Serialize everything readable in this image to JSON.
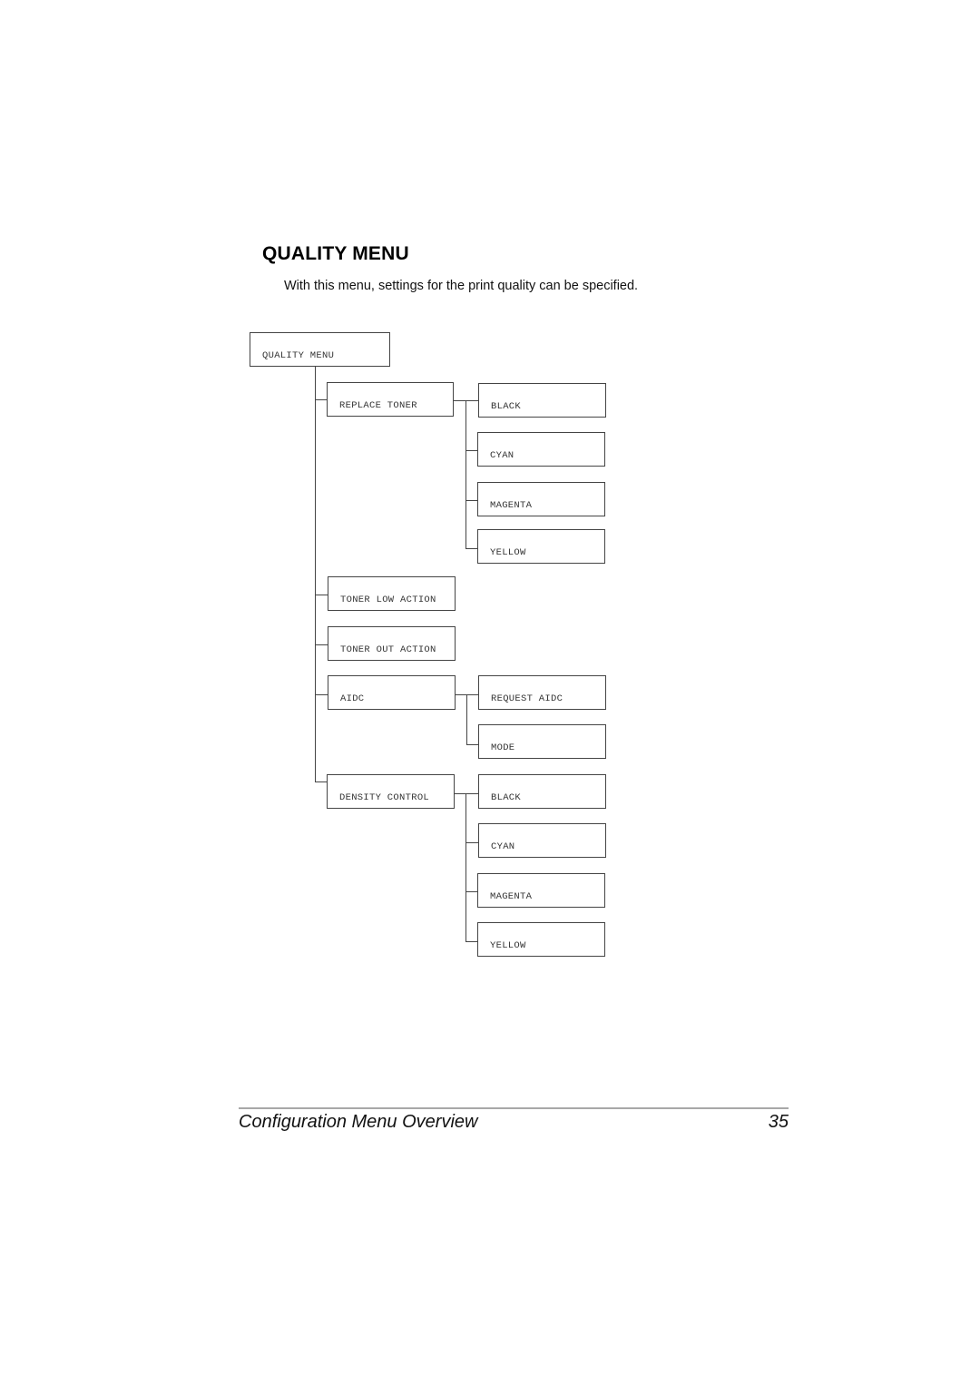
{
  "section": {
    "title": "QUALITY MENU",
    "intro": "With this menu, settings for the print quality can be specified."
  },
  "diagram": {
    "root": "QUALITY MENU",
    "items": [
      {
        "label": "REPLACE TONER",
        "children": [
          "BLACK",
          "CYAN",
          "MAGENTA",
          "YELLOW"
        ]
      },
      {
        "label": "TONER LOW ACTION",
        "children": []
      },
      {
        "label": "TONER OUT ACTION",
        "children": []
      },
      {
        "label": "AIDC",
        "children": [
          "REQUEST AIDC",
          "MODE"
        ]
      },
      {
        "label": "DENSITY CONTROL",
        "children": [
          "BLACK",
          "CYAN",
          "MAGENTA",
          "YELLOW"
        ]
      }
    ]
  },
  "footer": {
    "title": "Configuration Menu Overview",
    "page_number": "35"
  }
}
